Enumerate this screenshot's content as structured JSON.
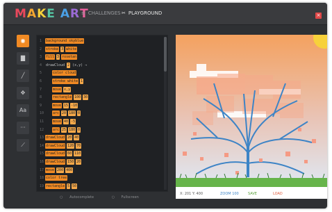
{
  "app": {
    "logo_letters": [
      "M",
      "A",
      "K",
      "E",
      " ",
      "A",
      "R",
      "T"
    ],
    "logo_colors": [
      "#e9485c",
      "#f4a630",
      "#f7d13b",
      "#56c5a4",
      "",
      "#4aa0e6",
      "#9b6bd6",
      "#ec5f9c"
    ],
    "close_glyph": "×"
  },
  "nav": {
    "challenges_icon": "≡",
    "challenges_label": "CHALLENGES",
    "playground_icon": "✂",
    "playground_label": "PLAYGROUND"
  },
  "toolbar": {
    "tools": [
      {
        "icon": "eye-icon",
        "glyph": "◉",
        "active": true
      },
      {
        "icon": "paint-roller-icon",
        "glyph": "▇",
        "active": false
      },
      {
        "icon": "pencil-icon",
        "glyph": "╱",
        "active": false
      },
      {
        "icon": "move-icon",
        "glyph": "✥",
        "active": false
      },
      {
        "icon": "text-icon",
        "glyph": "Aa",
        "active": false
      },
      {
        "icon": "more-icon",
        "glyph": "···",
        "active": false
      },
      {
        "icon": "wand-icon",
        "glyph": "⟋",
        "active": false
      }
    ]
  },
  "editor": {
    "lines": [
      {
        "n": "1",
        "indent": 0,
        "tokens": [
          {
            "t": "background skyblue",
            "k": "kw"
          }
        ]
      },
      {
        "n": "2",
        "indent": 0,
        "tokens": [
          {
            "t": "stroke",
            "k": "kw"
          },
          {
            "t": "3",
            "k": "num"
          },
          {
            "t": "white",
            "k": "kw"
          }
        ]
      },
      {
        "n": "3",
        "indent": 0,
        "tokens": [
          {
            "t": "fill",
            "k": "kw"
          },
          {
            "t": "3",
            "k": "num"
          },
          {
            "t": "rosetan",
            "k": "kw"
          }
        ]
      },
      {
        "n": "4",
        "indent": 0,
        "tokens": [
          {
            "t": "drawCloud",
            "k": "plain"
          },
          {
            "t": "2",
            "k": "num"
          },
          {
            "t": "(x,y) →",
            "k": "plain"
          }
        ]
      },
      {
        "n": "5",
        "indent": 1,
        "tokens": [
          {
            "t": "color cloud",
            "k": "kw"
          }
        ]
      },
      {
        "n": "6",
        "indent": 1,
        "tokens": [
          {
            "t": "stroke white",
            "k": "kw"
          },
          {
            "t": "1",
            "k": "num"
          }
        ]
      },
      {
        "n": "7",
        "indent": 1,
        "tokens": [
          {
            "t": "move",
            "k": "kw"
          },
          {
            "t": "x,y",
            "k": "num"
          }
        ]
      },
      {
        "n": "8",
        "indent": 1,
        "tokens": [
          {
            "t": "rectangle",
            "k": "kw"
          },
          {
            "t": "100",
            "k": "num"
          },
          {
            "t": "30",
            "k": "num"
          }
        ]
      },
      {
        "n": "9",
        "indent": 1,
        "tokens": [
          {
            "t": "move",
            "k": "kw"
          },
          {
            "t": "15",
            "k": "num"
          },
          {
            "t": "-10",
            "k": "num"
          }
        ]
      },
      {
        "n": "10",
        "indent": 1,
        "tokens": [
          {
            "t": "arc",
            "k": "kw"
          },
          {
            "t": "20",
            "k": "num"
          },
          {
            "t": "180",
            "k": "num"
          },
          {
            "t": "0",
            "k": "num"
          }
        ]
      },
      {
        "n": "11",
        "indent": 1,
        "tokens": [
          {
            "t": "move",
            "k": "kw"
          },
          {
            "t": "40",
            "k": "num"
          },
          {
            "t": "-5",
            "k": "num"
          }
        ]
      },
      {
        "n": "12",
        "indent": 1,
        "tokens": [
          {
            "t": "arc",
            "k": "kw"
          },
          {
            "t": "25",
            "k": "num"
          },
          {
            "t": "180",
            "k": "num"
          },
          {
            "t": "0",
            "k": "num"
          }
        ]
      },
      {
        "n": "13",
        "indent": 0,
        "tokens": [
          {
            "t": "drawCloud",
            "k": "kw"
          },
          {
            "t": "20",
            "k": "num"
          },
          {
            "t": "40",
            "k": "num"
          }
        ]
      },
      {
        "n": "14",
        "indent": 0,
        "tokens": [
          {
            "t": "drawCloud",
            "k": "kw"
          },
          {
            "t": "120",
            "k": "num"
          },
          {
            "t": "70",
            "k": "num"
          }
        ]
      },
      {
        "n": "15",
        "indent": 0,
        "tokens": [
          {
            "t": "drawCloud",
            "k": "kw"
          },
          {
            "t": "60",
            "k": "num"
          },
          {
            "t": "110",
            "k": "num"
          }
        ]
      },
      {
        "n": "16",
        "indent": 0,
        "tokens": [
          {
            "t": "drawCloud",
            "k": "kw"
          },
          {
            "t": "150",
            "k": "num"
          },
          {
            "t": "20",
            "k": "num"
          }
        ]
      },
      {
        "n": "17",
        "indent": 0,
        "tokens": [
          {
            "t": "move",
            "k": "kw"
          },
          {
            "t": "200",
            "k": "num"
          },
          {
            "t": "400",
            "k": "num"
          }
        ]
      },
      {
        "n": "18",
        "indent": 0,
        "tokens": [
          {
            "t": "color tree",
            "k": "kw"
          }
        ]
      },
      {
        "n": "19",
        "indent": 0,
        "tokens": [
          {
            "t": "rectangle",
            "k": "kw"
          },
          {
            "t": "5",
            "k": "num"
          },
          {
            "t": "50",
            "k": "num"
          }
        ]
      }
    ],
    "footer_autocomplete": "Autocomplete",
    "footer_fullscreen": "Fullscreen"
  },
  "status": {
    "cursor": "X: 201  Y: 400",
    "zoom": "ZOOM 100",
    "save": "SAVE",
    "load": "LOAD"
  },
  "colors": {
    "accent": "#f08a24",
    "sky_top": "#f4a15f",
    "sky_bottom": "#dde7f4",
    "tree": "#3d84c6",
    "grass": "#66b44a",
    "sun": "#f7d13b"
  }
}
